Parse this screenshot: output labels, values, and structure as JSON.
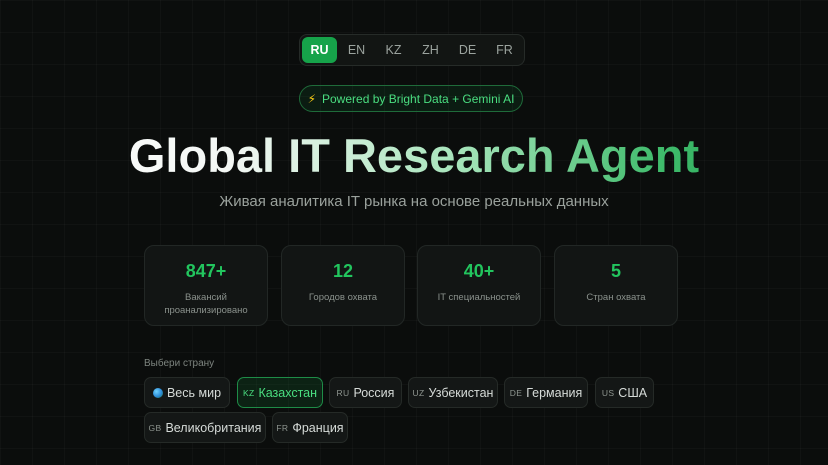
{
  "languages": [
    "RU",
    "EN",
    "KZ",
    "ZH",
    "DE",
    "FR"
  ],
  "active_language": "RU",
  "powered_badge": "Powered by Bright Data + Gemini AI",
  "title": "Global IT Research Agent",
  "subtitle": "Живая аналитика IT рынка на основе реальных данных",
  "stats": [
    {
      "value": "847+",
      "label": "Вакансий проанализировано"
    },
    {
      "value": "12",
      "label": "Городов охвата"
    },
    {
      "value": "40+",
      "label": "IT специальностей"
    },
    {
      "value": "5",
      "label": "Стран охвата"
    }
  ],
  "country_section_title": "Выбери страну",
  "countries": [
    {
      "code": "",
      "label": "Весь мир",
      "icon": "globe-icon"
    },
    {
      "code": "KZ",
      "label": "Казахстан",
      "active": true
    },
    {
      "code": "RU",
      "label": "Россия"
    },
    {
      "code": "UZ",
      "label": "Узбекистан"
    },
    {
      "code": "DE",
      "label": "Германия"
    },
    {
      "code": "US",
      "label": "США"
    },
    {
      "code": "GB",
      "label": "Великобритания"
    },
    {
      "code": "FR",
      "label": "Франция"
    }
  ],
  "colors": {
    "accent": "#22c55e",
    "accent_dark": "#16a34a",
    "background": "#0b0d0c",
    "card": "#121514"
  }
}
